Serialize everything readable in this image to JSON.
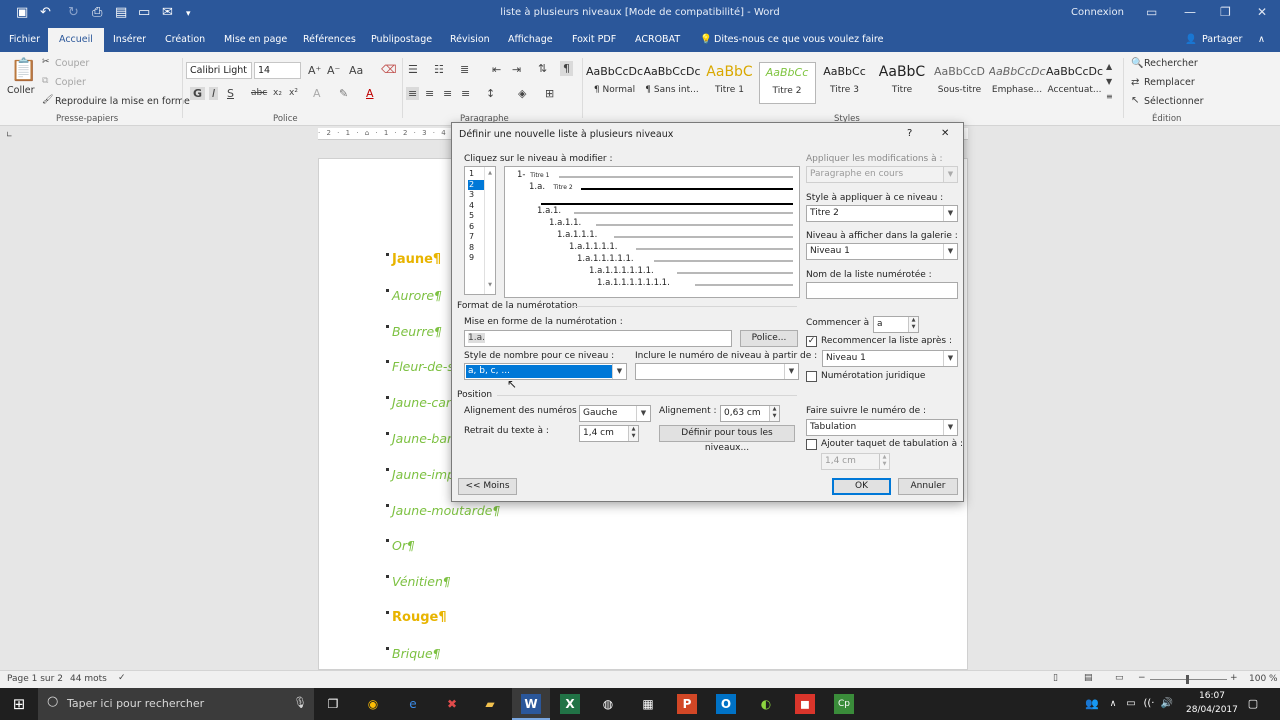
{
  "titlebar": {
    "doc_title": "liste à plusieurs niveaux [Mode de compatibilité] - Word",
    "connexion": "Connexion"
  },
  "tabs": [
    "Fichier",
    "Accueil",
    "Insérer",
    "Création",
    "Mise en page",
    "Références",
    "Publipostage",
    "Révision",
    "Affichage",
    "Foxit PDF",
    "ACROBAT"
  ],
  "active_tab": "Accueil",
  "tell_me": "Dites-nous ce que vous voulez faire",
  "share": "Partager",
  "ribbon": {
    "clipboard": {
      "paste": "Coller",
      "cut": "Couper",
      "copy": "Copier",
      "format_painter": "Reproduire la mise en forme",
      "label": "Presse-papiers"
    },
    "font": {
      "name": "Calibri Light",
      "size": "14",
      "label": "Police"
    },
    "paragraph": {
      "label": "Paragraphe"
    },
    "styles": {
      "label": "Styles",
      "tiles": [
        {
          "sample": "AaBbCcDc",
          "name": "¶ Normal",
          "color": "#222222"
        },
        {
          "sample": "AaBbCcDc",
          "name": "¶ Sans int...",
          "color": "#222222"
        },
        {
          "sample": "AaBbC",
          "name": "Titre 1",
          "color": "#d9a800"
        },
        {
          "sample": "AaBbCc",
          "name": "Titre 2",
          "color": "#7fc440"
        },
        {
          "sample": "AaBbCc",
          "name": "Titre 3",
          "color": "#222222"
        },
        {
          "sample": "AaBbC",
          "name": "Titre",
          "color": "#222222"
        },
        {
          "sample": "AaBbCcD",
          "name": "Sous-titre",
          "color": "#666666"
        },
        {
          "sample": "AaBbCcDc",
          "name": "Emphase...",
          "color": "#666666"
        },
        {
          "sample": "AaBbCcDc",
          "name": "Accentuat...",
          "color": "#222222"
        }
      ],
      "selected": "Titre 2"
    },
    "editing": {
      "find": "Rechercher",
      "replace": "Remplacer",
      "select": "Sélectionner",
      "label": "Édition"
    }
  },
  "document": {
    "items": [
      {
        "text": "Jaune¶",
        "color": "#e8b400",
        "bold": true
      },
      {
        "text": "Aurore¶",
        "color": "#7dc142",
        "bold": false
      },
      {
        "text": "Beurre¶",
        "color": "#7dc142",
        "bold": false
      },
      {
        "text": "Fleur-de-s",
        "color": "#7dc142",
        "bold": false
      },
      {
        "text": "Jaune-can",
        "color": "#7dc142",
        "bold": false
      },
      {
        "text": "Jaune-ban",
        "color": "#7dc142",
        "bold": false
      },
      {
        "text": "Jaune-imp",
        "color": "#7dc142",
        "bold": false
      },
      {
        "text": "Jaune-moutarde¶",
        "color": "#7dc142",
        "bold": false
      },
      {
        "text": "Or¶",
        "color": "#7dc142",
        "bold": false
      },
      {
        "text": "Vénitien¶",
        "color": "#7dc142",
        "bold": false
      },
      {
        "text": "Rouge¶",
        "color": "#e8b400",
        "bold": true
      },
      {
        "text": "Brique¶",
        "color": "#7dc142",
        "bold": false
      }
    ]
  },
  "statusbar": {
    "page": "Page 1 sur 2",
    "words": "44 mots",
    "zoom": "100 %"
  },
  "taskbar": {
    "search_placeholder": "Taper ici pour rechercher",
    "time": "16:07",
    "date": "28/04/2017"
  },
  "dialog": {
    "title": "Définir une nouvelle liste à plusieurs niveaux",
    "help": "?",
    "close": "✕",
    "level_prompt": "Cliquez sur le niveau à modifier :",
    "levels": [
      "1",
      "2",
      "3",
      "4",
      "5",
      "6",
      "7",
      "8",
      "9"
    ],
    "selected_level": "2",
    "preview": {
      "rows": [
        {
          "num": "1-",
          "label": "Titre 1"
        },
        {
          "num": "1.a.",
          "label": "Titre 2"
        },
        {
          "num": "",
          "label": ""
        },
        {
          "num": "1.a.1.",
          "label": ""
        },
        {
          "num": "1.a.1.1.",
          "label": ""
        },
        {
          "num": "1.a.1.1.1.",
          "label": ""
        },
        {
          "num": "1.a.1.1.1.1.",
          "label": ""
        },
        {
          "num": "1.a.1.1.1.1.1.",
          "label": ""
        },
        {
          "num": "1.a.1.1.1.1.1.1.",
          "label": ""
        },
        {
          "num": "1.a.1.1.1.1.1.1.1.",
          "label": ""
        }
      ]
    },
    "apply_to": {
      "label": "Appliquer les modifications à :",
      "value": "Paragraphe en cours"
    },
    "style_link": {
      "label": "Style à appliquer à ce niveau :",
      "value": "Titre 2"
    },
    "gallery_level": {
      "label": "Niveau à afficher dans la galerie :",
      "value": "Niveau 1"
    },
    "list_name": {
      "label": "Nom de la liste numérotée :",
      "value": ""
    },
    "number_format": {
      "section": "Format de la numérotation",
      "format_label": "Mise en forme de la numérotation :",
      "format_value": "1.a.",
      "font_button": "Police...",
      "style_label": "Style de nombre pour ce niveau :",
      "style_value": "a, b, c, ...",
      "include_label": "Inclure le numéro de niveau à partir de :",
      "include_value": ""
    },
    "start_at": {
      "label": "Commencer à :",
      "value": "a"
    },
    "restart": {
      "label": "Recommencer la liste après :",
      "checked": true,
      "value": "Niveau 1"
    },
    "legal": {
      "label": "Numérotation juridique",
      "checked": false
    },
    "position": {
      "section": "Position",
      "align_label": "Alignement des numéros :",
      "align_value": "Gauche",
      "at_label": "Alignement :",
      "at_value": "0,63 cm",
      "indent_label": "Retrait du texte à :",
      "indent_value": "1,4 cm",
      "set_all_button": "Définir pour tous les niveaux..."
    },
    "follow": {
      "label": "Faire suivre le numéro de :",
      "value": "Tabulation"
    },
    "tab_stop": {
      "label": "Ajouter taquet de tabulation à :",
      "checked": false,
      "value": "1,4 cm"
    },
    "less_button": "<< Moins",
    "ok": "OK",
    "cancel": "Annuler"
  }
}
